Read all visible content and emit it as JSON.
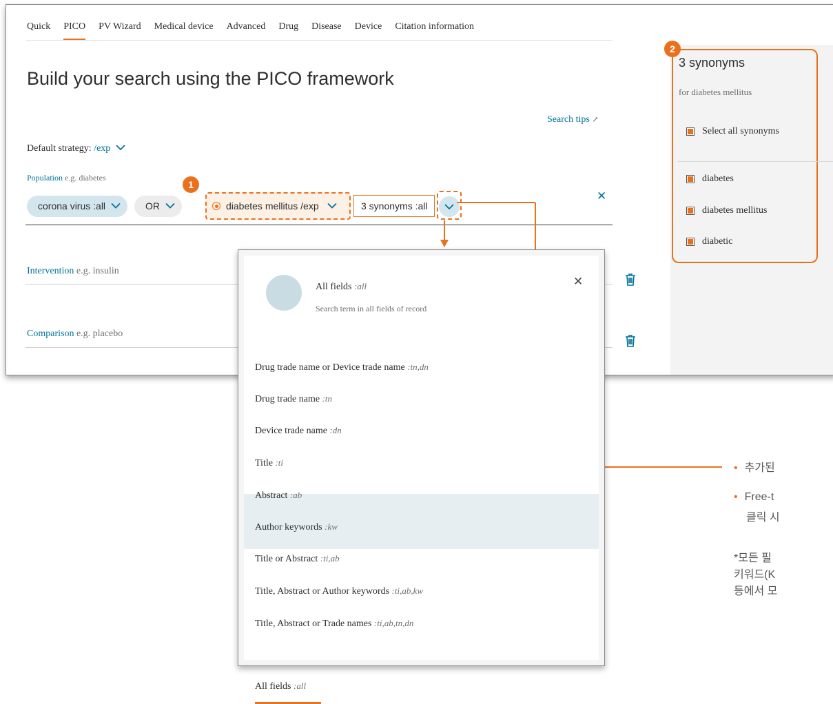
{
  "tabs": [
    "Quick",
    "PICO",
    "PV Wizard",
    "Medical device",
    "Advanced",
    "Drug",
    "Disease",
    "Device",
    "Citation information"
  ],
  "active_tab": "PICO",
  "heading": "Build your search using the PICO framework",
  "search_tips": "Search tips",
  "strategy": {
    "label": "Default strategy:",
    "value": "/exp"
  },
  "population": {
    "label": "Population",
    "example": "e.g. diabetes"
  },
  "chips": {
    "corona": "corona virus :all",
    "op": "OR",
    "term": "diabetes mellitus /exp",
    "synonyms": "3 synonyms :all"
  },
  "intervention": {
    "label": "Intervention",
    "example": "e.g. insulin"
  },
  "comparison": {
    "label": "Comparison",
    "example": "e.g. placebo"
  },
  "badges": {
    "one": "1",
    "two": "2"
  },
  "synonyms_panel": {
    "title": "3 synonyms",
    "subtitle": "for diabetes mellitus",
    "select_all": "Select all synonyms",
    "items": [
      "diabetes",
      "diabetes mellitus",
      "diabetic"
    ]
  },
  "dropdown": {
    "header_title": "All fields",
    "header_code": ":all",
    "header_sub": "Search term in all fields of record",
    "options": [
      {
        "label": "Drug trade name or Device trade name",
        "code": ":tn,dn"
      },
      {
        "label": "Drug trade name",
        "code": ":tn"
      },
      {
        "label": "Device trade name",
        "code": ":dn"
      },
      {
        "label": "Title",
        "code": ":ti"
      },
      {
        "label": "Abstract",
        "code": ":ab"
      },
      {
        "label": "Author keywords",
        "code": ":kw"
      },
      {
        "label": "Title or Abstract",
        "code": ":ti,ab"
      },
      {
        "label": "Title, Abstract or Author keywords",
        "code": ":ti,ab,kw"
      },
      {
        "label": "Title, Abstract or Trade names",
        "code": ":ti,ab,tn,dn"
      },
      {
        "label": "All fields",
        "code": ":all"
      }
    ]
  },
  "notes": {
    "bullet1": "추가된",
    "bullet2_line1": "Free-t",
    "bullet2_line2": "클릭 시",
    "foot_line1": "*모든 필",
    "foot_line2": "키워드(K",
    "foot_line3": "등에서 모"
  },
  "colors": {
    "accent": "#e9711c",
    "link": "#007398",
    "chip": "#d4e6ed"
  }
}
